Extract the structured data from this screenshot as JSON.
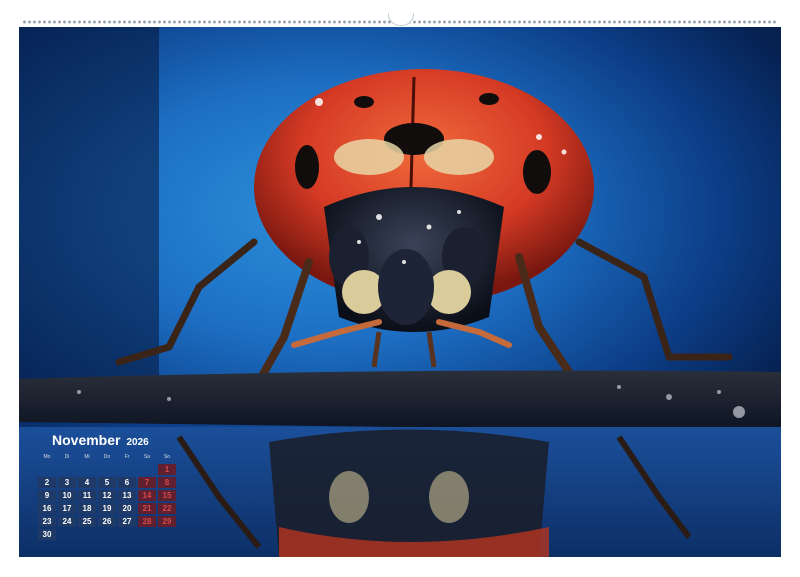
{
  "calendar": {
    "month": "November",
    "year": "2026",
    "weekdays": [
      "Mo",
      "Di",
      "Mi",
      "Do",
      "Fr",
      "Sa",
      "So"
    ],
    "weeks": [
      [
        "",
        "",
        "",
        "",
        "",
        "",
        "1"
      ],
      [
        "2",
        "3",
        "4",
        "5",
        "6",
        "7",
        "8"
      ],
      [
        "9",
        "10",
        "11",
        "12",
        "13",
        "14",
        "15"
      ],
      [
        "16",
        "17",
        "18",
        "19",
        "20",
        "21",
        "22"
      ],
      [
        "23",
        "24",
        "25",
        "26",
        "27",
        "28",
        "29"
      ],
      [
        "30",
        "",
        "",
        "",
        "",
        "",
        ""
      ]
    ]
  },
  "colors": {
    "background": "#1d6fc4",
    "shell": "#d53a24",
    "head": "#141a2a",
    "day_cell": "#1f3a66",
    "weekend_cell": "#612030"
  }
}
